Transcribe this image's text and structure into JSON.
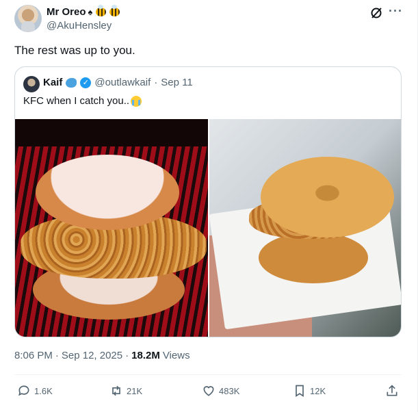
{
  "author": {
    "display_name": "Mr Oreo",
    "handle": "@AkuHensley",
    "name_emojis": [
      "spade-icon",
      "bee-icon",
      "bee-icon"
    ]
  },
  "tweet_text": "The rest was up to you.",
  "quoted": {
    "display_name": "Kaif",
    "handle": "@outlawkaif",
    "separator": "·",
    "date": "Sep 11",
    "text": "KFC when I catch you..",
    "text_emoji": "crying-face-icon",
    "media": [
      "kfc-donut-chicken-promo-image",
      "donut-chicken-sandwich-reality-image"
    ]
  },
  "meta": {
    "time": "8:06 PM",
    "separator1": "·",
    "date": "Sep 12, 2025",
    "separator2": "·",
    "views_count": "18.2M",
    "views_label": "Views"
  },
  "actions": {
    "reply_count": "1.6K",
    "repost_count": "21K",
    "like_count": "483K",
    "bookmark_count": "12K"
  },
  "colors": {
    "text_primary": "#0f1419",
    "text_secondary": "#536471",
    "border": "#cfd9de",
    "verified": "#1d9bf0"
  }
}
